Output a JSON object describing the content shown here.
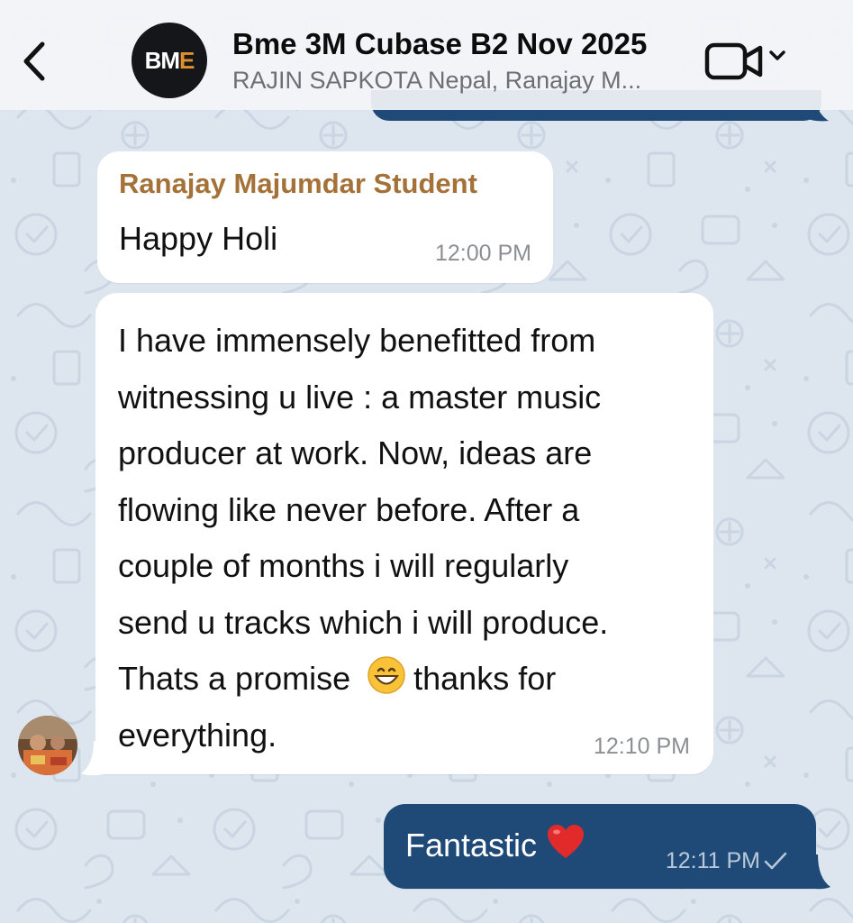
{
  "header": {
    "back_icon": "chevron-left-icon",
    "group_avatar": {
      "text_main": "BM",
      "text_accent": "E",
      "accent_color": "#e0902a"
    },
    "title": "Bme 3M Cubase B2 Nov 2025",
    "subtitle": "RAJIN SAPKOTA Nepal, Ranajay M...",
    "video_icon": "video-call-icon",
    "dropdown_icon": "chevron-down-icon"
  },
  "messages": [
    {
      "sender": "Ranajay Majumdar Student",
      "text": "Happy Holi",
      "time": "12:00 PM",
      "direction": "incoming"
    },
    {
      "lines": [
        "I have immensely benefitted from",
        "witnessing u live : a master music",
        "producer at work. Now, ideas are",
        "flowing like never before. After a",
        "couple of months i will regularly",
        "send u tracks which i will produce.",
        "Thats a promise",
        "thanks for",
        "everything."
      ],
      "emoji": "grinning-face-emoji",
      "time": "12:10 PM",
      "direction": "incoming"
    },
    {
      "text": "Fantastic",
      "emoji": "red-heart-emoji",
      "time": "12:11 PM",
      "status_icon": "sent-check-icon",
      "direction": "outgoing"
    }
  ],
  "colors": {
    "outgoing_bubble": "#1f4a78",
    "incoming_bubble": "#ffffff",
    "sender_name": "#a47238",
    "wallpaper": "#dde5ee"
  }
}
